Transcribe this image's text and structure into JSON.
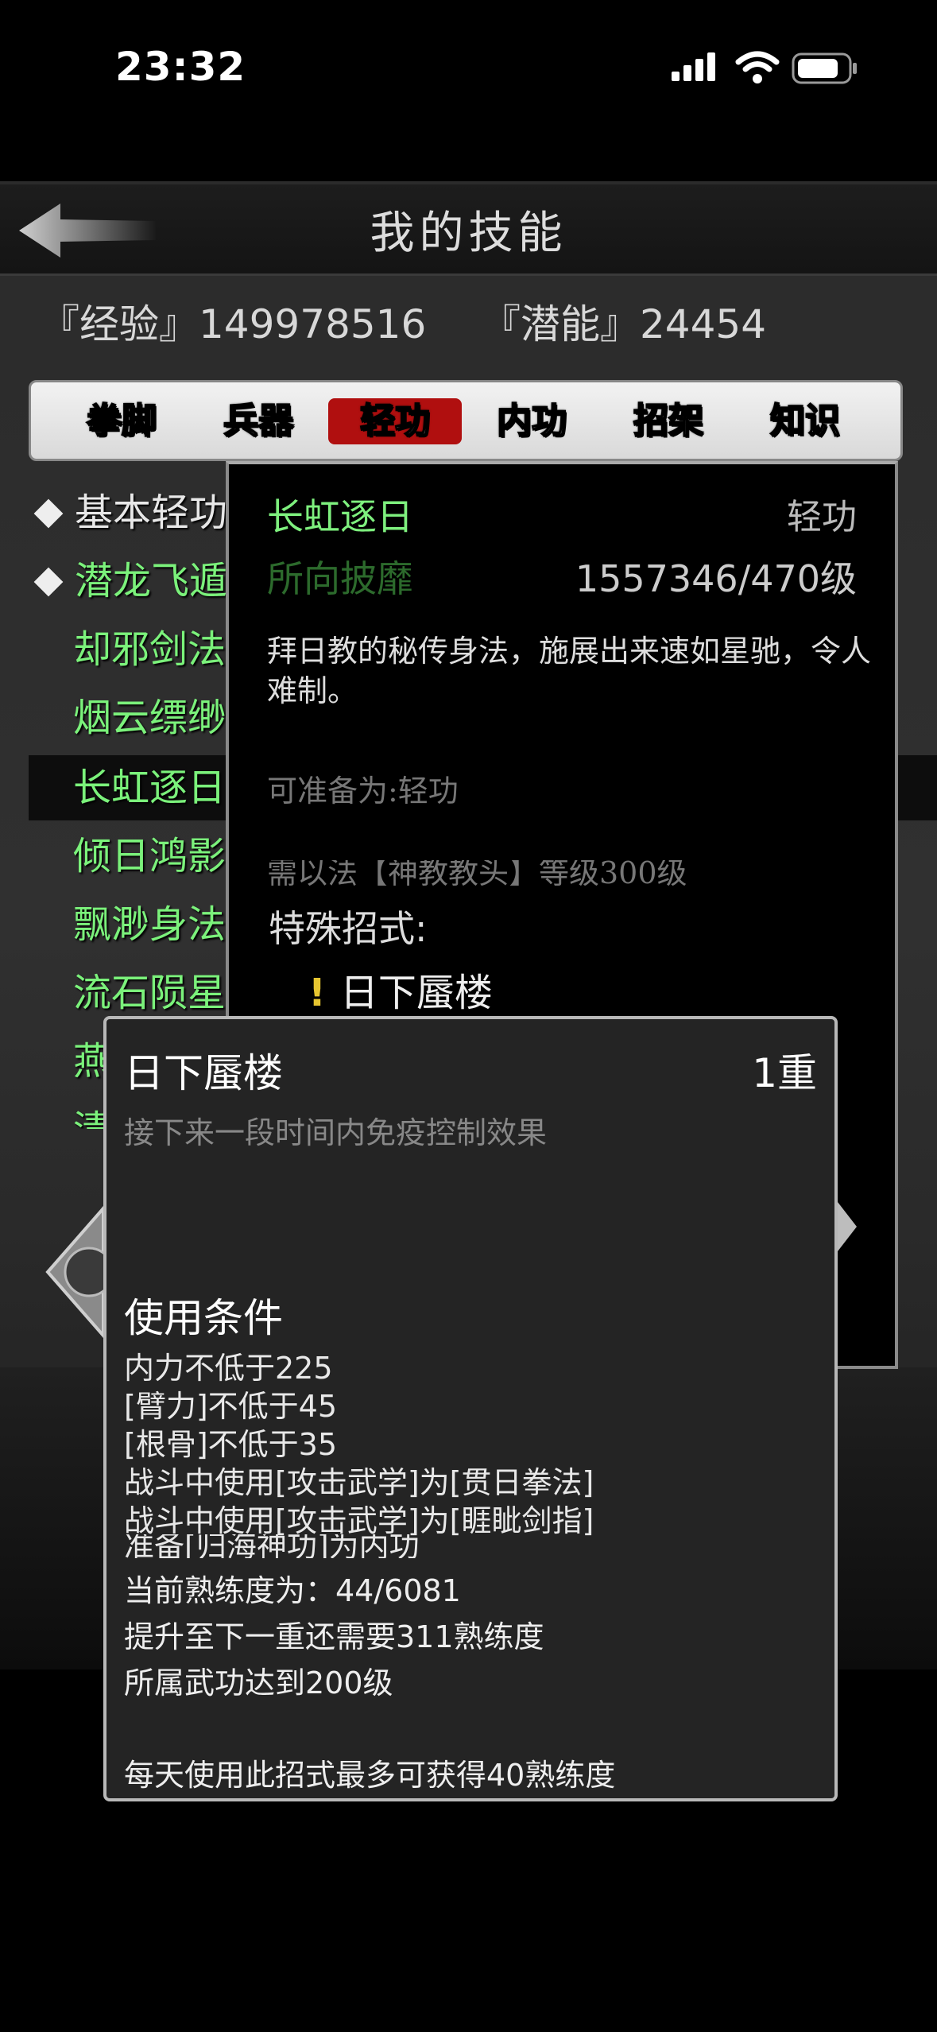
{
  "status_bar": {
    "time": "23:32"
  },
  "header": {
    "title": "我的技能"
  },
  "stats": {
    "exp": "『经验』149978516",
    "potential": "『潜能』24454"
  },
  "tabs": [
    "拳脚",
    "兵器",
    "轻功",
    "内功",
    "招架",
    "知识"
  ],
  "active_tab": "轻功",
  "skill_list": [
    {
      "label": "基本轻功",
      "kind": "basic"
    },
    {
      "label": "潜龙飞遁",
      "kind": "basic"
    },
    {
      "label": "却邪剑法",
      "kind": "sub"
    },
    {
      "label": "烟云缥缈",
      "kind": "sub"
    },
    {
      "label": "长虹逐日",
      "kind": "sub",
      "selected": true
    },
    {
      "label": "倾日鸿影",
      "kind": "sub"
    },
    {
      "label": "飘渺身法",
      "kind": "sub"
    },
    {
      "label": "流石陨星",
      "kind": "sub"
    },
    {
      "label": "燕",
      "kind": "sub"
    },
    {
      "label": "清",
      "kind": "sub"
    }
  ],
  "detail": {
    "name": "长虹逐日",
    "type": "轻功",
    "move_name": "所向披靡",
    "level": "1557346/470级",
    "description": "拜日教的秘传身法，施展出来速如星驰，令人难制。",
    "prep": "可准备为:轻功",
    "requirement": "需以法【神教教头】等级300级",
    "special_title": "特殊招式:",
    "special_item": "日下蜃楼",
    "special_mark": "!"
  },
  "move_popup": {
    "name": "日下蜃楼",
    "rank": "1重",
    "effect": "接下来一段时间内免疫控制效果",
    "conditions_title": "使用条件",
    "conditions": [
      "内力不低于225",
      "[臂力]不低于45",
      "[根骨]不低于35",
      "战斗中使用[攻击武学]为[贯日拳法]",
      "战斗中使用[攻击武学]为[睚眦剑指]",
      "准备[归海神功]为内功"
    ],
    "proficiency": "当前熟练度为：44/6081",
    "next_rank": "提升至下一重还需要311熟练度",
    "skill_level": "所属武功达到200级",
    "daily_cap": "每天使用此招式最多可获得40熟练度"
  },
  "colors": {
    "accent_green": "#7ef07e",
    "tab_active": "#b00f0f",
    "mark_yellow": "#e6c530"
  }
}
